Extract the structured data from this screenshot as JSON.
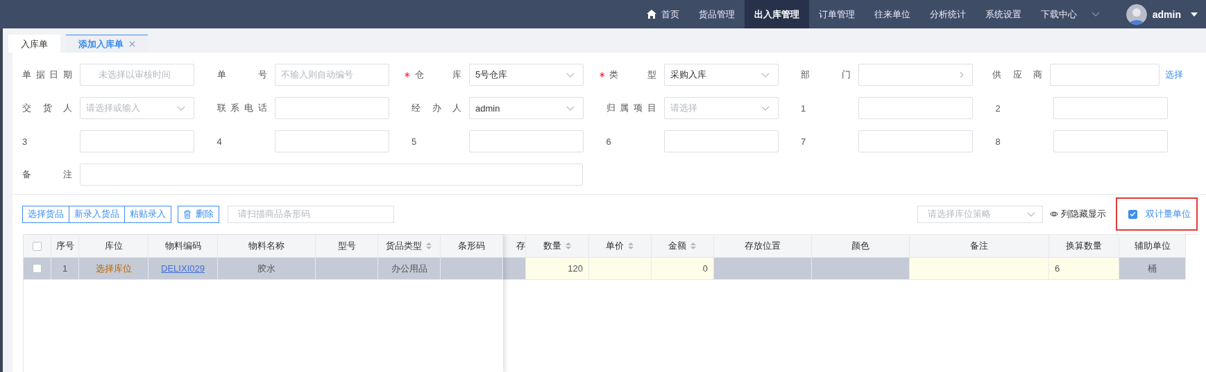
{
  "nav": {
    "items": [
      {
        "label": "首页",
        "kind": "home",
        "selected": false
      },
      {
        "label": "货品管理",
        "kind": "plain",
        "selected": false
      },
      {
        "label": "出入库管理",
        "kind": "plain",
        "selected": true
      },
      {
        "label": "订单管理",
        "kind": "plain",
        "selected": false
      },
      {
        "label": "往来单位",
        "kind": "plain",
        "selected": false
      },
      {
        "label": "分析统计",
        "kind": "plain",
        "selected": false
      },
      {
        "label": "系统设置",
        "kind": "plain",
        "selected": false
      },
      {
        "label": "下载中心",
        "kind": "dropdown",
        "selected": false
      }
    ],
    "user": {
      "name": "admin"
    }
  },
  "tabs": [
    {
      "label": "入库单",
      "selected": false,
      "closable": false
    },
    {
      "label": "添加入库单",
      "selected": true,
      "closable": true
    }
  ],
  "form": {
    "fields": [
      {
        "label": "单据日期",
        "kind": "date",
        "required": false,
        "placeholder": "未选择以审核时间"
      },
      {
        "label": "单号",
        "kind": "text",
        "required": false,
        "placeholder": "不输入则自动编号"
      },
      {
        "label": "仓库",
        "kind": "select",
        "required": true,
        "value": "5号仓库"
      },
      {
        "label": "类型",
        "kind": "select",
        "required": true,
        "value": "采购入库"
      },
      {
        "label": "部门",
        "kind": "cascader",
        "required": false
      },
      {
        "label": "供应商",
        "kind": "text",
        "required": false,
        "action": "选择"
      },
      {
        "label": "交货人",
        "kind": "select",
        "required": false,
        "placeholder": "请选择或输入"
      },
      {
        "label": "联系电话",
        "kind": "text",
        "required": false
      },
      {
        "label": "经办人",
        "kind": "select",
        "required": false,
        "value": "admin"
      },
      {
        "label": "归属项目",
        "kind": "select",
        "required": false,
        "placeholder": "请选择"
      },
      {
        "label": "1",
        "kind": "text",
        "required": false
      },
      {
        "label": "2",
        "kind": "text",
        "required": false
      },
      {
        "label": "3",
        "kind": "text",
        "required": false
      },
      {
        "label": "4",
        "kind": "text",
        "required": false
      },
      {
        "label": "5",
        "kind": "text",
        "required": false
      },
      {
        "label": "6",
        "kind": "text",
        "required": false
      },
      {
        "label": "7",
        "kind": "text",
        "required": false
      },
      {
        "label": "8",
        "kind": "text",
        "required": false
      },
      {
        "label": "备注",
        "kind": "wide",
        "required": false
      }
    ]
  },
  "toolbar": {
    "group_buttons": [
      "选择货品",
      "新录入货品",
      "粘贴录入"
    ],
    "delete_button": "删除",
    "scan_field": {
      "placeholder": "请扫描商品条形码"
    },
    "strategy_select": {
      "placeholder": "请选择库位策略"
    },
    "column_toggle": "列隐藏显示",
    "dual_unit": {
      "label": "双计量单位",
      "checked": true,
      "highlighted": true
    }
  },
  "table": {
    "header_checkbox": {
      "checked": false
    },
    "fixed_columns": [
      {
        "label": "序号",
        "sortable": false
      },
      {
        "label": "库位",
        "sortable": false
      },
      {
        "label": "物料编码",
        "sortable": false
      },
      {
        "label": "物料名称",
        "sortable": false
      },
      {
        "label": "型号",
        "sortable": false
      },
      {
        "label": "货品类型",
        "sortable": true
      },
      {
        "label": "条形码",
        "sortable": false
      }
    ],
    "scroll_columns": [
      {
        "label": "存",
        "sortable": false
      },
      {
        "label": "数量",
        "sortable": true
      },
      {
        "label": "单价",
        "sortable": true
      },
      {
        "label": "金额",
        "sortable": true
      },
      {
        "label": "存放位置",
        "sortable": false
      },
      {
        "label": "颜色",
        "sortable": false
      },
      {
        "label": "备注",
        "sortable": false
      },
      {
        "label": "换算数量",
        "sortable": false
      },
      {
        "label": "辅助单位",
        "sortable": false
      }
    ],
    "rows": [
      {
        "selected": true,
        "checked": false,
        "fixed_cells": [
          {
            "kind": "text",
            "text": "1"
          },
          {
            "kind": "action",
            "text": "选择库位"
          },
          {
            "kind": "code",
            "text": "DELIXI029"
          },
          {
            "kind": "text",
            "text": "胶水"
          },
          {
            "kind": "text"
          },
          {
            "kind": "text",
            "text": "办公用品"
          },
          {
            "kind": "text"
          }
        ],
        "scroll_cells": [
          {
            "kind": "text"
          },
          {
            "kind": "number-input",
            "text": "120"
          },
          {
            "kind": "number-input"
          },
          {
            "kind": "number-input",
            "text": "0"
          },
          {
            "kind": "text"
          },
          {
            "kind": "text"
          },
          {
            "kind": "text-input"
          },
          {
            "kind": "text-input",
            "text": "6"
          },
          {
            "kind": "text",
            "text": "桶"
          }
        ]
      }
    ]
  }
}
